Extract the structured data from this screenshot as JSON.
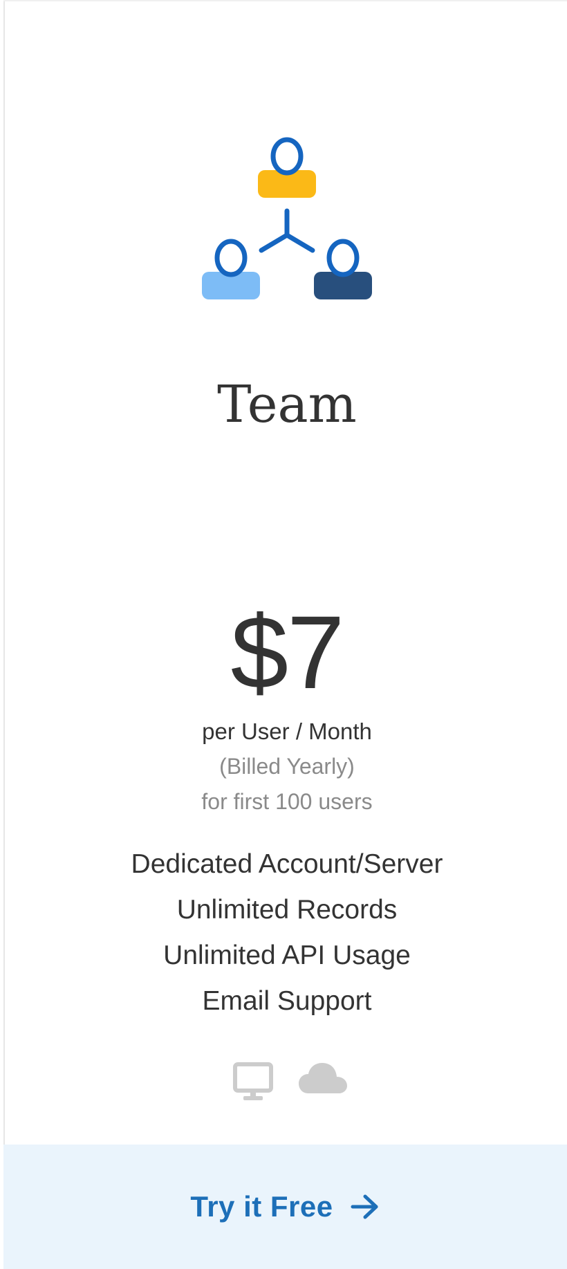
{
  "plan": {
    "name": "Team",
    "price": "$7",
    "price_unit": "per User / Month",
    "billing_note": "(Billed Yearly)",
    "limit_note": "for first 100 users"
  },
  "features": [
    "Dedicated Account/Server",
    "Unlimited Records",
    "Unlimited API Usage",
    "Email Support"
  ],
  "icons": {
    "plan": "team-network-icon",
    "platforms": [
      "desktop-icon",
      "cloud-icon"
    ],
    "cta": "arrow-right-icon"
  },
  "cta": {
    "label": "Try it Free"
  },
  "colors": {
    "text": "#333333",
    "muted": "#8a8a8a",
    "accent": "#1d6fb8",
    "cta_bg": "#eaf4fc",
    "person_top": "#fbb917",
    "person_left": "#7dbcf6",
    "person_right": "#284f7d",
    "person_outline": "#1565c0",
    "platform_icon": "#cccccc"
  }
}
